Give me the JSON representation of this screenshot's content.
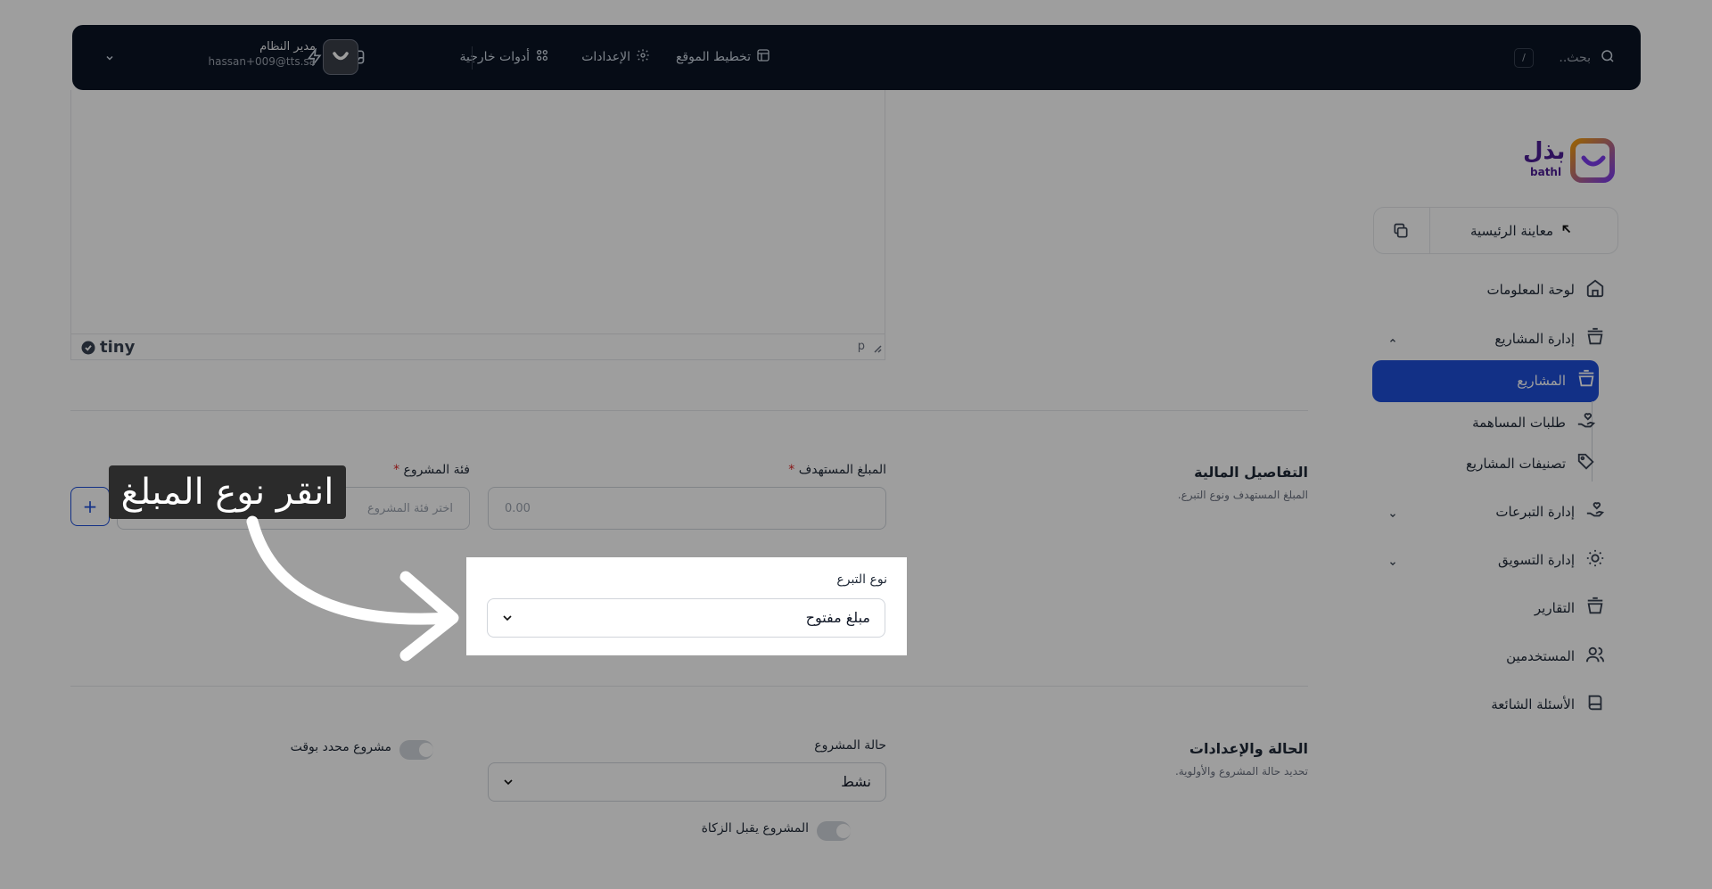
{
  "topbar": {
    "search_placeholder": "بحث..",
    "search_shortcut": "/",
    "links": [
      {
        "label": "تخطيط الموقع",
        "icon": "layout-icon"
      },
      {
        "label": "الإعدادات",
        "icon": "gear-icon"
      },
      {
        "label": "أدوات خارجية",
        "icon": "grid-icon"
      }
    ],
    "user": {
      "name": "مدير النظام",
      "email": "hassan+009@tts.sa"
    }
  },
  "sidebar": {
    "logo_text": "بذل",
    "logo_latin": "bathl",
    "preview_label": "معاينة الرئيسية",
    "items": [
      {
        "label": "لوحة المعلومات",
        "icon": "home-icon"
      },
      {
        "label": "إدارة المشاريع",
        "icon": "box-icon",
        "expanded": true
      },
      {
        "label": "المشاريع",
        "icon": "box-icon",
        "active": true
      },
      {
        "label": "طلبات المساهمة",
        "icon": "hand-heart-icon"
      },
      {
        "label": "تصنيفات المشاريع",
        "icon": "tag-icon"
      },
      {
        "label": "إدارة التبرعات",
        "icon": "hand-heart-icon"
      },
      {
        "label": "إدارة التسويق",
        "icon": "sun-icon"
      },
      {
        "label": "التقارير",
        "icon": "box-icon"
      },
      {
        "label": "المستخدمين",
        "icon": "users-icon"
      },
      {
        "label": "الأسئلة الشائعة",
        "icon": "help-icon"
      }
    ]
  },
  "editor": {
    "brand": "tiny",
    "path": "p"
  },
  "financial": {
    "title": "التفاصيل المالية",
    "subtitle": "المبلغ المستهدف ونوع التبرع.",
    "target_label": "المبلغ المستهدف",
    "target_placeholder": "0.00",
    "category_label": "فئة المشروع",
    "category_placeholder": "اختر فئة المشروع",
    "donation_type_label": "نوع التبرع",
    "donation_type_value": "مبلغ مفتوح"
  },
  "status": {
    "title": "الحالة والإعدادات",
    "subtitle": "تحديد حالة المشروع والأولوية.",
    "project_status_label": "حالة المشروع",
    "project_status_value": "نشط",
    "timed_label": "مشروع محدد بوقت",
    "zakat_label": "المشروع يقبل الزكاة"
  },
  "tutorial": {
    "callout": "انقر نوع المبلغ"
  },
  "colors": {
    "primary": "#1d4ed8",
    "topbar": "#0b1424",
    "overlay": "rgba(0,0,0,0.38)"
  }
}
